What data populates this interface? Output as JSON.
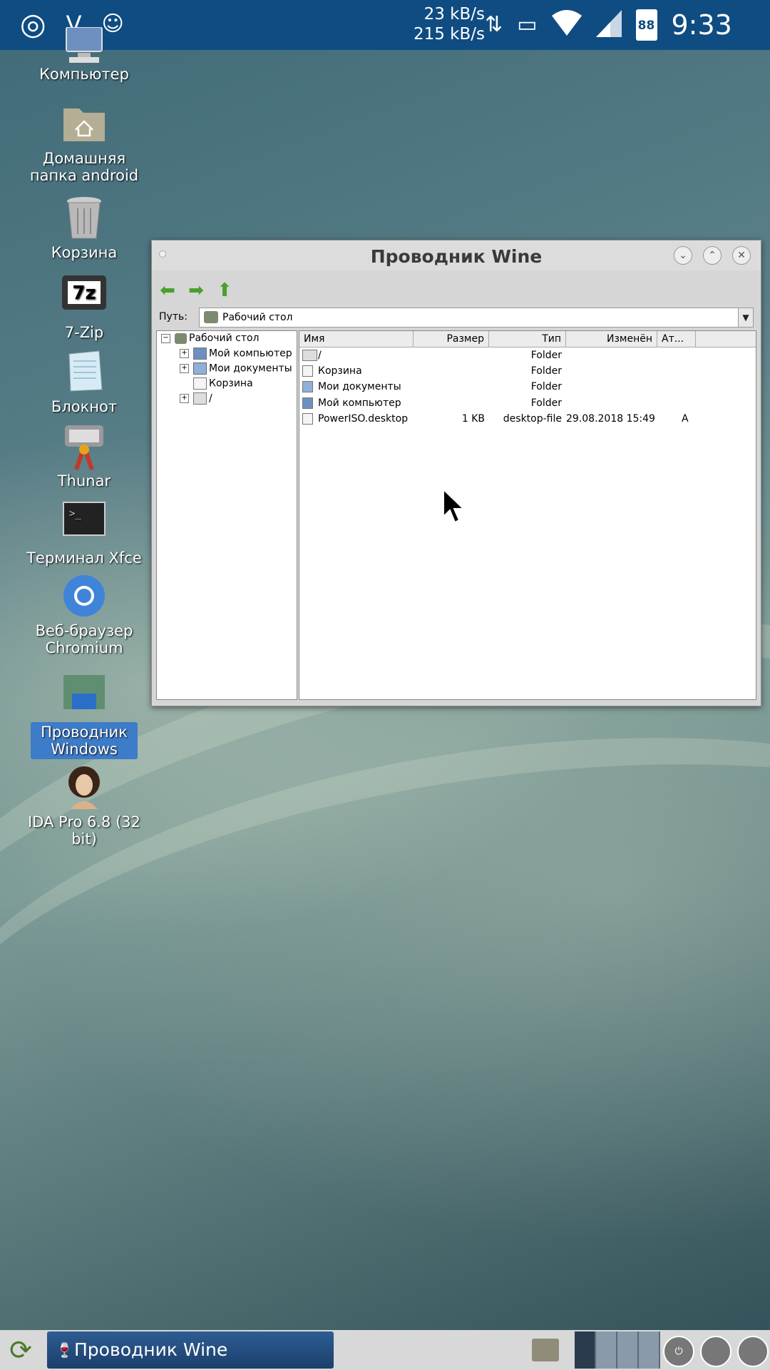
{
  "status_bar": {
    "speed_down": "23 kB/s",
    "speed_up": "215 kB/s",
    "battery": "88",
    "time": "9:33",
    "left_icons": [
      "app-logo-icon",
      "vnc-icon",
      "android-debug-icon"
    ],
    "right_icons": [
      "data-transfer-icon",
      "cast-icon",
      "wifi-icon",
      "signal-icon",
      "battery-icon"
    ]
  },
  "desktop_icons": [
    {
      "label": "Компьютер",
      "icon": "computer-icon"
    },
    {
      "label": "Домашняя папка android",
      "icon": "home-folder-icon"
    },
    {
      "label": "Корзина",
      "icon": "trash-icon"
    },
    {
      "label": "7-Zip",
      "icon": "7zip-icon"
    },
    {
      "label": "Блокнот",
      "icon": "notepad-icon"
    },
    {
      "label": "Thunar",
      "icon": "thunar-icon"
    },
    {
      "label": "Терминал Xfce",
      "icon": "terminal-icon"
    },
    {
      "label": "Веб-браузер Chromium",
      "icon": "chromium-icon"
    },
    {
      "label": "Проводник Windows",
      "icon": "explorer-icon",
      "selected": true
    },
    {
      "label": "IDA Pro 6.8 (32 bit)",
      "icon": "ida-pro-icon"
    }
  ],
  "window": {
    "title": "Проводник Wine",
    "path_label": "Путь:",
    "path_value": "Рабочий стол",
    "tree": [
      {
        "label": "Рабочий стол",
        "expander": "−",
        "level": 0
      },
      {
        "label": "Мой компьютер",
        "expander": "+",
        "level": 1
      },
      {
        "label": "Мои документы",
        "expander": "+",
        "level": 1
      },
      {
        "label": "Корзина",
        "expander": "",
        "level": 1
      },
      {
        "label": "/",
        "expander": "+",
        "level": 1
      }
    ],
    "columns": [
      "Имя",
      "Размер",
      "Тип",
      "Изменён",
      "Ат..."
    ],
    "rows": [
      {
        "name": "/",
        "size": "",
        "type": "Folder",
        "modified": "",
        "attr": ""
      },
      {
        "name": "Корзина",
        "size": "",
        "type": "Folder",
        "modified": "",
        "attr": ""
      },
      {
        "name": "Мои документы",
        "size": "",
        "type": "Folder",
        "modified": "",
        "attr": ""
      },
      {
        "name": "Мой компьютер",
        "size": "",
        "type": "Folder",
        "modified": "",
        "attr": ""
      },
      {
        "name": "PowerISO.desktop",
        "size": "1 KB",
        "type": "desktop-file",
        "modified": "29.08.2018 15:49",
        "attr": "A"
      }
    ]
  },
  "taskbar": {
    "task_label": "Проводник Wine"
  }
}
